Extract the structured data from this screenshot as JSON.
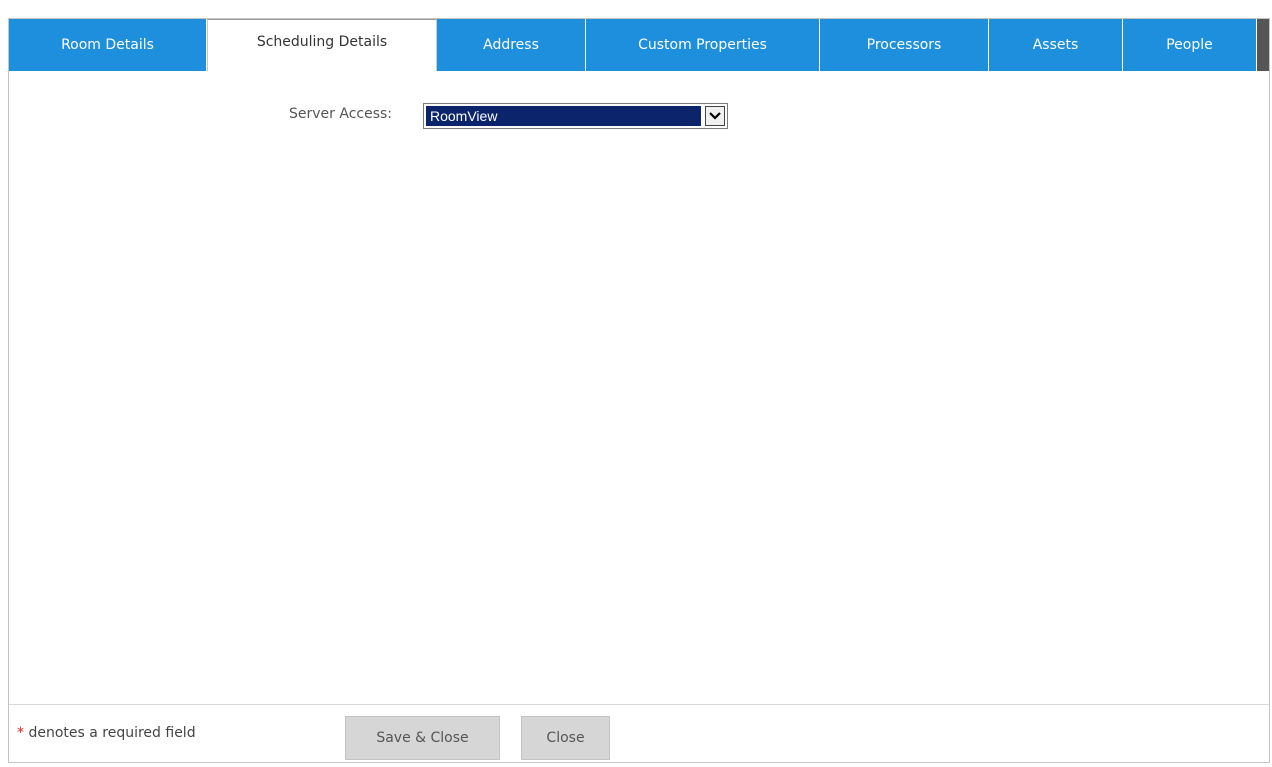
{
  "tabs": [
    {
      "label": "Room Details",
      "active": false
    },
    {
      "label": "Scheduling Details",
      "active": true
    },
    {
      "label": "Address",
      "active": false
    },
    {
      "label": "Custom Properties",
      "active": false
    },
    {
      "label": "Processors",
      "active": false
    },
    {
      "label": "Assets",
      "active": false
    },
    {
      "label": "People",
      "active": false
    }
  ],
  "form": {
    "server_access_label": "Server Access:",
    "server_access_value": "RoomView"
  },
  "footer": {
    "required_star": "*",
    "required_text": " denotes a required field",
    "save_close_label": "Save & Close",
    "close_label": "Close"
  },
  "colors": {
    "tab_background": "#1d8fdc",
    "tabbar_background": "#555555",
    "select_highlight": "#0c246b",
    "button_disabled": "#d6d6d6",
    "required_star": "#e02020"
  },
  "icons": {
    "select_arrow": "chevron-down-icon"
  }
}
